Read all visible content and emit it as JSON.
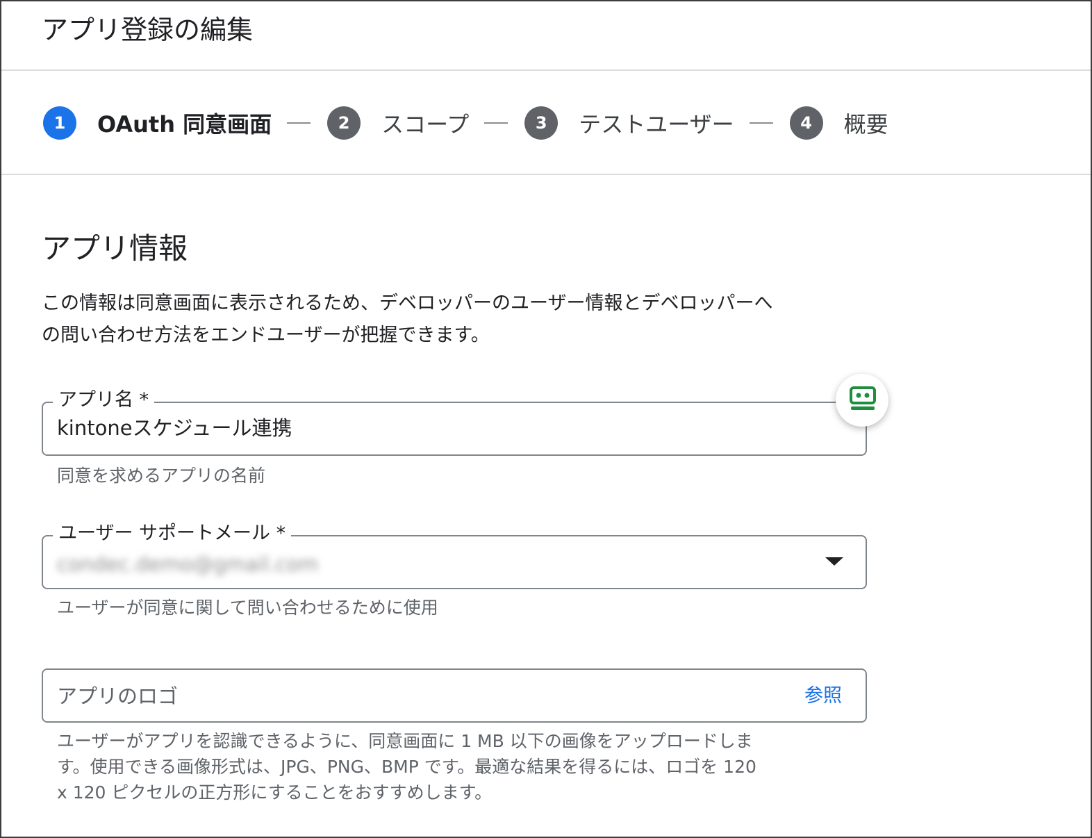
{
  "page": {
    "title": "アプリ登録の編集"
  },
  "stepper": {
    "steps": [
      {
        "number": "1",
        "label": "OAuth 同意画面",
        "state": "active"
      },
      {
        "number": "2",
        "label": "スコープ",
        "state": "inactive"
      },
      {
        "number": "3",
        "label": "テストユーザー",
        "state": "inactive"
      },
      {
        "number": "4",
        "label": "概要",
        "state": "inactive"
      }
    ]
  },
  "section": {
    "title": "アプリ情報",
    "description_line1": "この情報は同意画面に表示されるため、デベロッパーのユーザー情報とデベロッパーへ",
    "description_line2": "の問い合わせ方法をエンドユーザーが把握できます。"
  },
  "fields": {
    "app_name": {
      "label": "アプリ名 *",
      "value": "kintoneスケジュール連携",
      "helper": "同意を求めるアプリの名前"
    },
    "support_email": {
      "label": "ユーザー サポートメール *",
      "value": "condec.demo@gmail.com",
      "helper": "ユーザーが同意に関して問い合わせるために使用"
    },
    "app_logo": {
      "placeholder": "アプリのロゴ",
      "browse_label": "参照",
      "helper_line1": "ユーザーがアプリを認識できるように、同意画面に 1 MB 以下の画像をアップロードしま",
      "helper_line2": "す。使用できる画像形式は、JPG、PNG、BMP です。最適な結果を得るには、ロゴを 120",
      "helper_line3": "x 120 ピクセルの正方形にすることをおすすめします。"
    }
  },
  "colors": {
    "accent": "#1a73e8",
    "step_inactive": "#5f6368",
    "extension_icon": "#1e8e3e"
  },
  "icons": {
    "extension": "password-manager-icon",
    "dropdown": "dropdown-arrow-icon"
  }
}
